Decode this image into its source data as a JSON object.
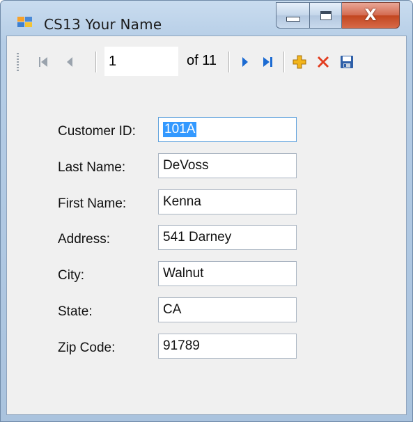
{
  "window": {
    "title": "CS13 Your Name",
    "close_symbol": "X"
  },
  "navigator": {
    "position": "1",
    "count_text": "of 11"
  },
  "form": {
    "fields": [
      {
        "label": "Customer ID:",
        "value": "101A"
      },
      {
        "label": "Last Name:",
        "value": "DeVoss"
      },
      {
        "label": "First Name:",
        "value": "Kenna"
      },
      {
        "label": "Address:",
        "value": "541 Darney"
      },
      {
        "label": "City:",
        "value": "Walnut"
      },
      {
        "label": "State:",
        "value": "CA"
      },
      {
        "label": "Zip Code:",
        "value": "91789"
      }
    ]
  },
  "colors": {
    "selection": "#3399ff",
    "add_icon": "#f2b51c",
    "delete_icon": "#e23b1d",
    "nav_arrows": "#1c6bd2",
    "save_icon": "#2e5fa8"
  },
  "icons": [
    "app-icon",
    "move-first-icon",
    "move-previous-icon",
    "move-next-icon",
    "move-last-icon",
    "add-new-icon",
    "delete-icon",
    "save-icon"
  ]
}
